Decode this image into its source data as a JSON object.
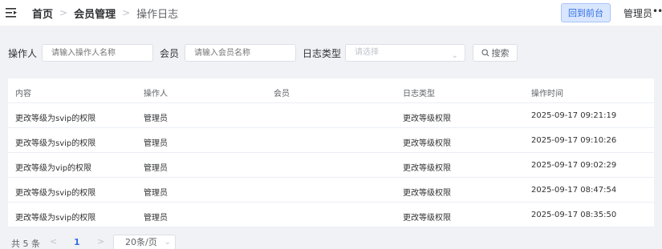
{
  "header": {
    "breadcrumb": [
      "首页",
      "会员管理",
      "操作日志"
    ],
    "front_button": "回到前台",
    "user_name": "管理员",
    "more": "•••"
  },
  "filter": {
    "operator_label": "操作人",
    "operator_placeholder": "请输入操作人名称",
    "member_label": "会员",
    "member_placeholder": "请输入会员名称",
    "log_type_label": "日志类型",
    "log_type_placeholder": "请选择",
    "search_button": "搜索",
    "icons": {
      "search": "search-icon",
      "select": "chevron-down-icon"
    }
  },
  "table": {
    "columns": [
      "内容",
      "操作人",
      "会员",
      "日志类型",
      "操作时间"
    ],
    "rows": [
      [
        "更改等级为svip的权限",
        "管理员",
        "",
        "更改等级权限",
        "2025-09-17 09:21:19"
      ],
      [
        "更改等级为svip的权限",
        "管理员",
        "",
        "更改等级权限",
        "2025-09-17 09:10:26"
      ],
      [
        "更改等级为vip的权限",
        "管理员",
        "",
        "更改等级权限",
        "2025-09-17 09:02:29"
      ],
      [
        "更改等级为svip的权限",
        "管理员",
        "",
        "更改等级权限",
        "2025-09-17 08:47:54"
      ],
      [
        "更改等级为svip的权限",
        "管理员",
        "",
        "更改等级权限",
        "2025-09-17 08:35:50"
      ]
    ]
  },
  "pagination": {
    "total": "共 5 条",
    "prev": "<",
    "current_page": "1",
    "next": ">",
    "page_size": "20条/页"
  },
  "colors": {
    "accent": "#3370e0",
    "front_button_bg": "#d9e6ff",
    "page_bg": "#f0f2f5"
  }
}
